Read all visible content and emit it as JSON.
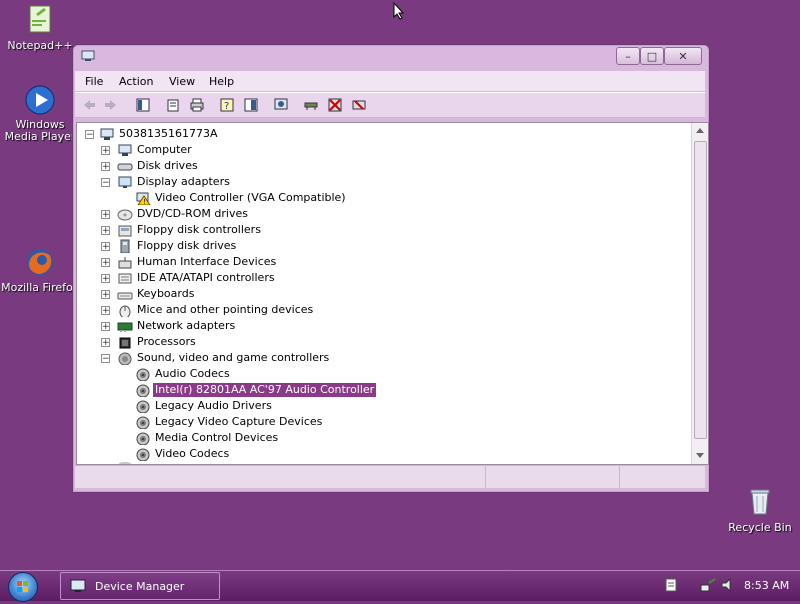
{
  "desktop": {
    "icons": [
      {
        "label": "Notepad++"
      },
      {
        "label": "Windows Media Player"
      },
      {
        "label": "Mozilla Firefox"
      },
      {
        "label": "Recycle Bin"
      }
    ]
  },
  "window": {
    "title": "Device Manager",
    "controls": {
      "minimize": "–",
      "maximize": "□",
      "close": "✕"
    },
    "menu": [
      "File",
      "Action",
      "View",
      "Help"
    ],
    "toolbar_icons": [
      "back-icon",
      "forward-icon",
      "console-tree-icon",
      "properties-icon",
      "print-icon",
      "help-icon",
      "show-hide-icon",
      "scan-hardware-icon",
      "update-driver-icon",
      "disable-icon",
      "uninstall-icon"
    ]
  },
  "tree": {
    "root": "5038135161773A",
    "items": [
      {
        "label": "Computer",
        "expander": "+",
        "icon": "computer-icon"
      },
      {
        "label": "Disk drives",
        "expander": "+",
        "icon": "disk-drive-icon"
      },
      {
        "label": "Display adapters",
        "expander": "−",
        "icon": "display-adapter-icon"
      },
      {
        "label": "Video Controller (VGA Compatible)",
        "child": true,
        "icon": "warning-device-icon"
      },
      {
        "label": "DVD/CD-ROM drives",
        "expander": "+",
        "icon": "dvd-icon"
      },
      {
        "label": "Floppy disk controllers",
        "expander": "+",
        "icon": "floppy-controller-icon"
      },
      {
        "label": "Floppy disk drives",
        "expander": "+",
        "icon": "floppy-drive-icon"
      },
      {
        "label": "Human Interface Devices",
        "expander": "+",
        "icon": "hid-icon"
      },
      {
        "label": "IDE ATA/ATAPI controllers",
        "expander": "+",
        "icon": "ide-icon"
      },
      {
        "label": "Keyboards",
        "expander": "+",
        "icon": "keyboard-icon"
      },
      {
        "label": "Mice and other pointing devices",
        "expander": "+",
        "icon": "mouse-icon"
      },
      {
        "label": "Network adapters",
        "expander": "+",
        "icon": "network-icon"
      },
      {
        "label": "Processors",
        "expander": "+",
        "icon": "processor-icon"
      },
      {
        "label": "Sound, video and game controllers",
        "expander": "−",
        "icon": "sound-icon"
      },
      {
        "label": "Audio Codecs",
        "child": true,
        "icon": "speaker-icon"
      },
      {
        "label": "Intel(r) 82801AA AC'97 Audio Controller",
        "child": true,
        "selected": true,
        "icon": "speaker-icon"
      },
      {
        "label": "Legacy Audio Drivers",
        "child": true,
        "icon": "speaker-icon"
      },
      {
        "label": "Legacy Video Capture Devices",
        "child": true,
        "icon": "speaker-icon"
      },
      {
        "label": "Media Control Devices",
        "child": true,
        "icon": "speaker-icon"
      },
      {
        "label": "Video Codecs",
        "child": true,
        "icon": "speaker-icon"
      }
    ]
  },
  "taskbar": {
    "active_task": "Device Manager",
    "clock": "8:53 AM"
  },
  "colors": {
    "desktop": "#7a3a80",
    "selection": "#8a3a86"
  }
}
